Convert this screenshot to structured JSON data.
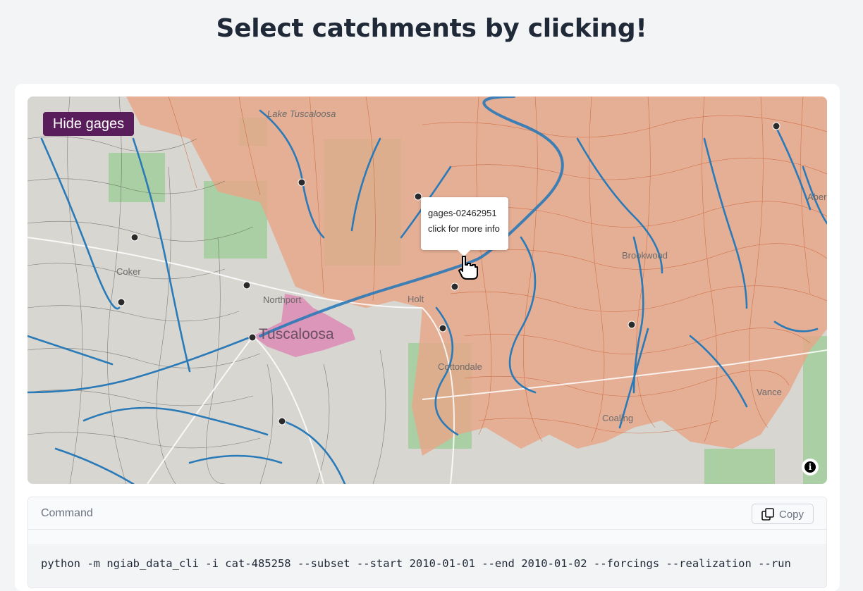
{
  "page_title": "Select catchments by clicking!",
  "map": {
    "toggle_label": "Hide gages",
    "popup": {
      "gage_id": "gages-02462951",
      "hint": "click for more info"
    },
    "place_labels": {
      "lake": "Lake Tuscaloosa",
      "coker": "Coker",
      "northport": "Northport",
      "tuscaloosa": "Tuscaloosa",
      "holt": "Holt",
      "brookwood": "Brookwood",
      "cottondale": "Cottondale",
      "coaling": "Coaling",
      "vance": "Vance",
      "abernant": "Aber"
    },
    "colors": {
      "selected_region": "#e8a688",
      "highlight_catchment": "#e06aa8",
      "rivers": "#2a7ab8",
      "gage_marker": "#2b2b2b",
      "button": "#5a1d5c"
    }
  },
  "command": {
    "header": "Command",
    "copy_label": "Copy",
    "text": "python -m ngiab_data_cli -i cat-485258 --subset --start 2010-01-01 --end 2010-01-02 --forcings --realization --run"
  }
}
